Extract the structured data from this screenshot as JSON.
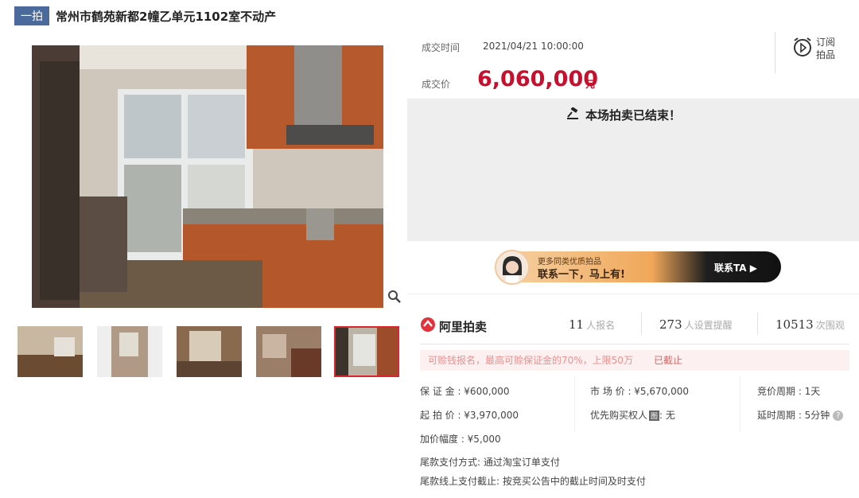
{
  "header": {
    "tag": "一拍",
    "title": "常州市鹤苑新都2幢乙单元1102室不动产"
  },
  "deal": {
    "time_label": "成交时间",
    "time_value": "2021/04/21 10:00:00",
    "price_label": "成交价",
    "price_value": "6,060,000",
    "price_unit": "元"
  },
  "subscribe": {
    "line1": "订阅",
    "line2": "拍品"
  },
  "status": {
    "ended": "本场拍卖已结束！"
  },
  "banner": {
    "line1": "更多同类优质拍品",
    "line2": "联系一下，马上有!",
    "cta": "联系TA"
  },
  "platform": {
    "name": "阿里拍卖"
  },
  "stats": [
    {
      "num": "11",
      "label": "人报名"
    },
    {
      "num": "273",
      "label": "人设置提醒"
    },
    {
      "num": "10513",
      "label": "次围观"
    }
  ],
  "notice": {
    "text": "可赊钱报名，最高可赊保证金的70%，上限50万",
    "cutoff": "已截止"
  },
  "info": {
    "deposit": "保 证 金 : ¥600,000",
    "start_price": "起 拍 价 : ¥3,970,000",
    "increment": "加价幅度 : ¥5,000",
    "market_price": "市 场 价 : ¥5,670,000",
    "priority_buyer": "优先购买权人",
    "priority_badge": "图",
    "priority_value": ": 无",
    "bid_cycle": "竞价周期 : 1天",
    "delay_cycle": "延时周期 : 5分钟",
    "help": "?",
    "payment_method": "尾款支付方式:   通过淘宝订单支付",
    "payment_deadline": "尾款线上支付截止:   按竞买公告中的截止时间及时支付"
  },
  "colors": {
    "accent": "#c8102e",
    "tag": "#4a6a9c"
  }
}
